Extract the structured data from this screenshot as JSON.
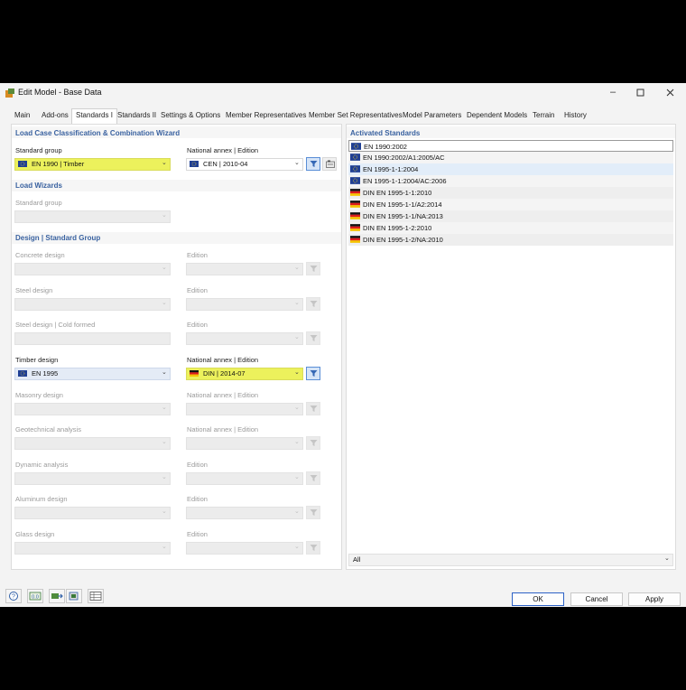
{
  "window": {
    "title": "Edit Model - Base Data"
  },
  "tabs": [
    {
      "label": "Main"
    },
    {
      "label": "Add-ons"
    },
    {
      "label": "Standards I"
    },
    {
      "label": "Standards II"
    },
    {
      "label": "Settings & Options"
    },
    {
      "label": "Member Representatives"
    },
    {
      "label": "Member Set Representatives"
    },
    {
      "label": "Model Parameters"
    },
    {
      "label": "Dependent Models"
    },
    {
      "label": "Terrain"
    },
    {
      "label": "History"
    }
  ],
  "load_case": {
    "heading": "Load Case Classification & Combination Wizard",
    "standard_group_label": "Standard group",
    "standard_group_value": "EN 1990 | Timber",
    "annex_label": "National annex | Edition",
    "annex_value": "CEN | 2010-04"
  },
  "load_wizards": {
    "heading": "Load Wizards",
    "standard_group_label": "Standard group"
  },
  "design": {
    "heading": "Design | Standard Group",
    "rows": [
      {
        "left_label": "Concrete design",
        "right_label": "Edition",
        "left_value": "",
        "right_value": ""
      },
      {
        "left_label": "Steel design",
        "right_label": "Edition",
        "left_value": "",
        "right_value": ""
      },
      {
        "left_label": "Steel design | Cold formed",
        "right_label": "Edition",
        "left_value": "",
        "right_value": ""
      },
      {
        "left_label": "Timber design",
        "right_label": "National annex | Edition",
        "left_value": "EN 1995",
        "right_value": "DIN | 2014-07"
      },
      {
        "left_label": "Masonry design",
        "right_label": "National annex | Edition",
        "left_value": "",
        "right_value": ""
      },
      {
        "left_label": "Geotechnical analysis",
        "right_label": "National annex | Edition",
        "left_value": "",
        "right_value": ""
      },
      {
        "left_label": "Dynamic analysis",
        "right_label": "Edition",
        "left_value": "",
        "right_value": ""
      },
      {
        "left_label": "Aluminum design",
        "right_label": "Edition",
        "left_value": "",
        "right_value": ""
      },
      {
        "left_label": "Glass design",
        "right_label": "Edition",
        "left_value": "",
        "right_value": ""
      }
    ]
  },
  "activated": {
    "heading": "Activated Standards",
    "items": [
      {
        "flag": "eu",
        "text": "EN 1990:2002"
      },
      {
        "flag": "eu",
        "text": "EN 1990:2002/A1:2005/AC"
      },
      {
        "flag": "eu",
        "text": "EN 1995-1-1:2004"
      },
      {
        "flag": "eu",
        "text": "EN 1995-1-1:2004/AC:2006"
      },
      {
        "flag": "de",
        "text": "DIN EN 1995-1-1:2010"
      },
      {
        "flag": "de",
        "text": "DIN EN 1995-1-1/A2:2014"
      },
      {
        "flag": "de",
        "text": "DIN EN 1995-1-1/NA:2013"
      },
      {
        "flag": "de",
        "text": "DIN EN 1995-1-2:2010"
      },
      {
        "flag": "de",
        "text": "DIN EN 1995-1-2/NA:2010"
      }
    ],
    "filter_value": "All"
  },
  "buttons": {
    "ok": "OK",
    "cancel": "Cancel",
    "apply": "Apply"
  },
  "colors": {
    "heading": "#3a62a0",
    "highlight": "#ecf15c",
    "selection": "#e4ebf6",
    "primary_border": "#2d62c6"
  }
}
